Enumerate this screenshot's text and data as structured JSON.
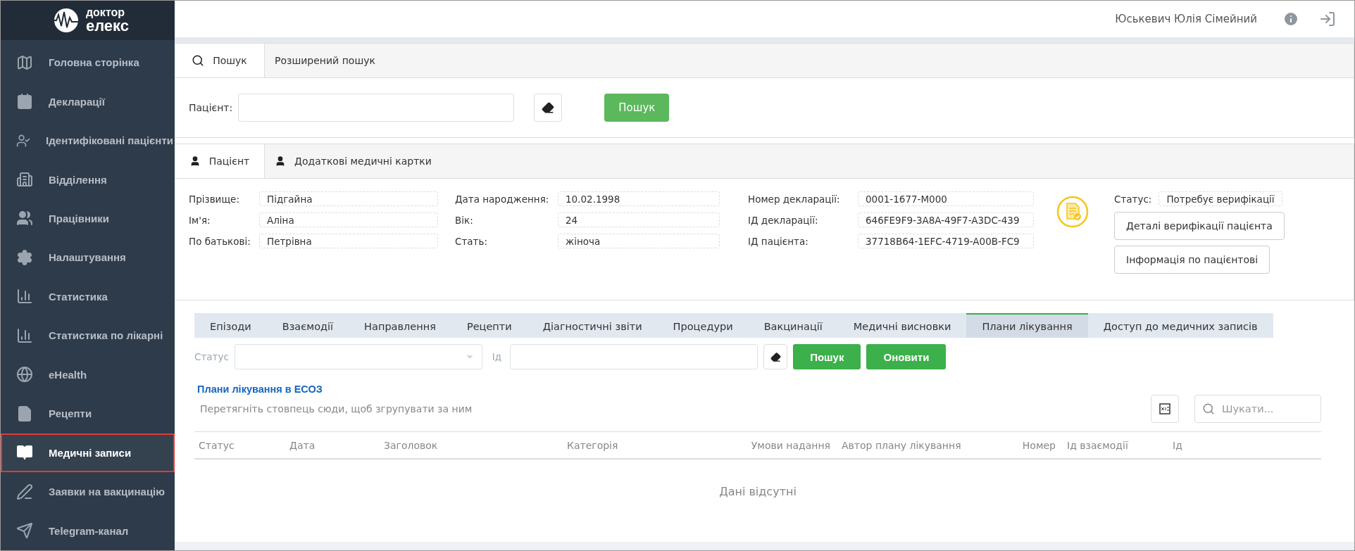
{
  "logo": {
    "line1": "доктор",
    "line2": "елекс"
  },
  "sidebar": {
    "items": [
      {
        "label": "Головна сторінка",
        "selected": false
      },
      {
        "label": "Декларації",
        "selected": false
      },
      {
        "label": "Ідентифіковані пацієнти",
        "selected": false
      },
      {
        "label": "Відділення",
        "selected": false
      },
      {
        "label": "Працівники",
        "selected": false
      },
      {
        "label": "Налаштування",
        "selected": false
      },
      {
        "label": "Статистика",
        "selected": false
      },
      {
        "label": "Статистика по лікарні",
        "selected": false
      },
      {
        "label": "eHealth",
        "selected": false
      },
      {
        "label": "Рецепти",
        "selected": false
      },
      {
        "label": "Медичні записи",
        "selected": true
      },
      {
        "label": "Заявки на вакцинацію",
        "selected": false
      },
      {
        "label": "Telegram-канал",
        "selected": false
      }
    ]
  },
  "header": {
    "user": "Юськевич Юлія Сімейний"
  },
  "search_tabs": [
    {
      "label": "Пошук",
      "selected": true
    },
    {
      "label": "Розширений пошук",
      "selected": false
    }
  ],
  "search": {
    "label": "Пацієнт:",
    "button": "Пошук"
  },
  "patient_tabs": [
    {
      "label": "Пацієнт",
      "selected": true
    },
    {
      "label": "Додаткові медичні картки",
      "selected": false
    }
  ],
  "patient_columns": [
    [
      {
        "label": "Прізвище:",
        "value": "Підгайна"
      },
      {
        "label": "Ім'я:",
        "value": "Аліна"
      },
      {
        "label": "По батькові:",
        "value": "Петрівна"
      }
    ],
    [
      {
        "label": "Дата народження:",
        "value": "10.02.1998"
      },
      {
        "label": "Вік:",
        "value": "24"
      },
      {
        "label": "Стать:",
        "value": "жіноча"
      }
    ],
    [
      {
        "label": "Номер декларації:",
        "value": "0001-1677-M000"
      },
      {
        "label": "ІД декларації:",
        "value": "646FE9F9-3A8A-49F7-A3DC-439"
      },
      {
        "label": "ІД пацієнта:",
        "value": "37718B64-1EFC-4719-A00B-FC9"
      }
    ]
  ],
  "status": {
    "label": "Статус:",
    "value": "Потребує верифікації"
  },
  "patient_buttons": [
    "Деталі верифікації пацієнта",
    "Інформація по пацієнтові"
  ],
  "record_tabs": [
    {
      "label": "Епізоди",
      "selected": false
    },
    {
      "label": "Взаємодії",
      "selected": false
    },
    {
      "label": "Направлення",
      "selected": false
    },
    {
      "label": "Рецепти",
      "selected": false
    },
    {
      "label": "Діагностичні звіти",
      "selected": false
    },
    {
      "label": "Процедури",
      "selected": false
    },
    {
      "label": "Вакцинації",
      "selected": false
    },
    {
      "label": "Медичні висновки",
      "selected": false
    },
    {
      "label": "Плани лікування",
      "selected": true
    },
    {
      "label": "Доступ до медичних записів",
      "selected": false
    }
  ],
  "filter": {
    "status_label": "Статус",
    "id_label": "Ід",
    "search_button": "Пошук",
    "refresh_button": "Оновити"
  },
  "section_title": "Плани лікування в ЕСОЗ",
  "group_hint": "Перетягніть стовпець сюди, щоб згрупувати за ним",
  "grid_search": {
    "placeholder": "Шукати..."
  },
  "table": {
    "columns": [
      "Статус",
      "Дата",
      "Заголовок",
      "Категорія",
      "Умови надання",
      "Автор плану лікування",
      "Номер",
      "Ід взаємодії",
      "Ід"
    ],
    "empty": "Дані відсутні"
  }
}
